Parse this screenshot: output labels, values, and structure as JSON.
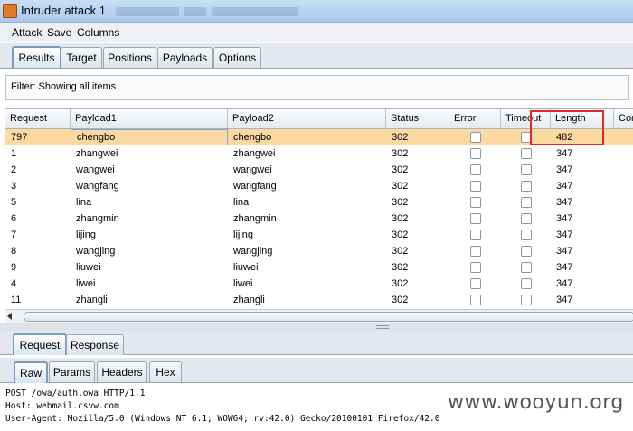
{
  "window": {
    "title": "Intruder attack 1"
  },
  "menu": {
    "items": [
      "Attack",
      "Save",
      "Columns"
    ]
  },
  "tabs": {
    "items": [
      "Results",
      "Target",
      "Positions",
      "Payloads",
      "Options"
    ],
    "active": 0
  },
  "filter": {
    "text": "Filter:  Showing all items"
  },
  "table": {
    "columns": [
      "Request",
      "Payload1",
      "Payload2",
      "Status",
      "Error",
      "Timeout",
      "Length",
      "Com"
    ],
    "rows": [
      {
        "request": "797",
        "payload1": "chengbo",
        "payload2": "chengbo",
        "status": "302",
        "error": false,
        "timeout": false,
        "length": "482",
        "selected": true
      },
      {
        "request": "1",
        "payload1": "zhangwei",
        "payload2": "zhangwei",
        "status": "302",
        "error": false,
        "timeout": false,
        "length": "347"
      },
      {
        "request": "2",
        "payload1": "wangwei",
        "payload2": "wangwei",
        "status": "302",
        "error": false,
        "timeout": false,
        "length": "347"
      },
      {
        "request": "3",
        "payload1": "wangfang",
        "payload2": "wangfang",
        "status": "302",
        "error": false,
        "timeout": false,
        "length": "347"
      },
      {
        "request": "5",
        "payload1": "lina",
        "payload2": "lina",
        "status": "302",
        "error": false,
        "timeout": false,
        "length": "347"
      },
      {
        "request": "6",
        "payload1": "zhangmin",
        "payload2": "zhangmin",
        "status": "302",
        "error": false,
        "timeout": false,
        "length": "347"
      },
      {
        "request": "7",
        "payload1": "lijing",
        "payload2": "lijing",
        "status": "302",
        "error": false,
        "timeout": false,
        "length": "347"
      },
      {
        "request": "8",
        "payload1": "wangjing",
        "payload2": "wangjing",
        "status": "302",
        "error": false,
        "timeout": false,
        "length": "347"
      },
      {
        "request": "9",
        "payload1": "liuwei",
        "payload2": "liuwei",
        "status": "302",
        "error": false,
        "timeout": false,
        "length": "347"
      },
      {
        "request": "4",
        "payload1": "liwei",
        "payload2": "liwei",
        "status": "302",
        "error": false,
        "timeout": false,
        "length": "347"
      },
      {
        "request": "11",
        "payload1": "zhangli",
        "payload2": "zhangli",
        "status": "302",
        "error": false,
        "timeout": false,
        "length": "347"
      }
    ]
  },
  "detail_tabs": {
    "items": [
      "Request",
      "Response"
    ],
    "active": 0
  },
  "message_tabs": {
    "items": [
      "Raw",
      "Params",
      "Headers",
      "Hex"
    ],
    "active": 0
  },
  "request_text": [
    "POST /owa/auth.owa HTTP/1.1",
    "Host: webmail.csvw.com",
    "User-Agent: Mozilla/5.0 (Windows NT 6.1; WOW64; rv:42.0) Gecko/20100101 Firefox/42.0"
  ],
  "watermark": "www.wooyun.org",
  "colors": {
    "selected_row": "#fcd9a0",
    "highlight_box": "#e2262a",
    "titlebar": "#aac8ee"
  }
}
